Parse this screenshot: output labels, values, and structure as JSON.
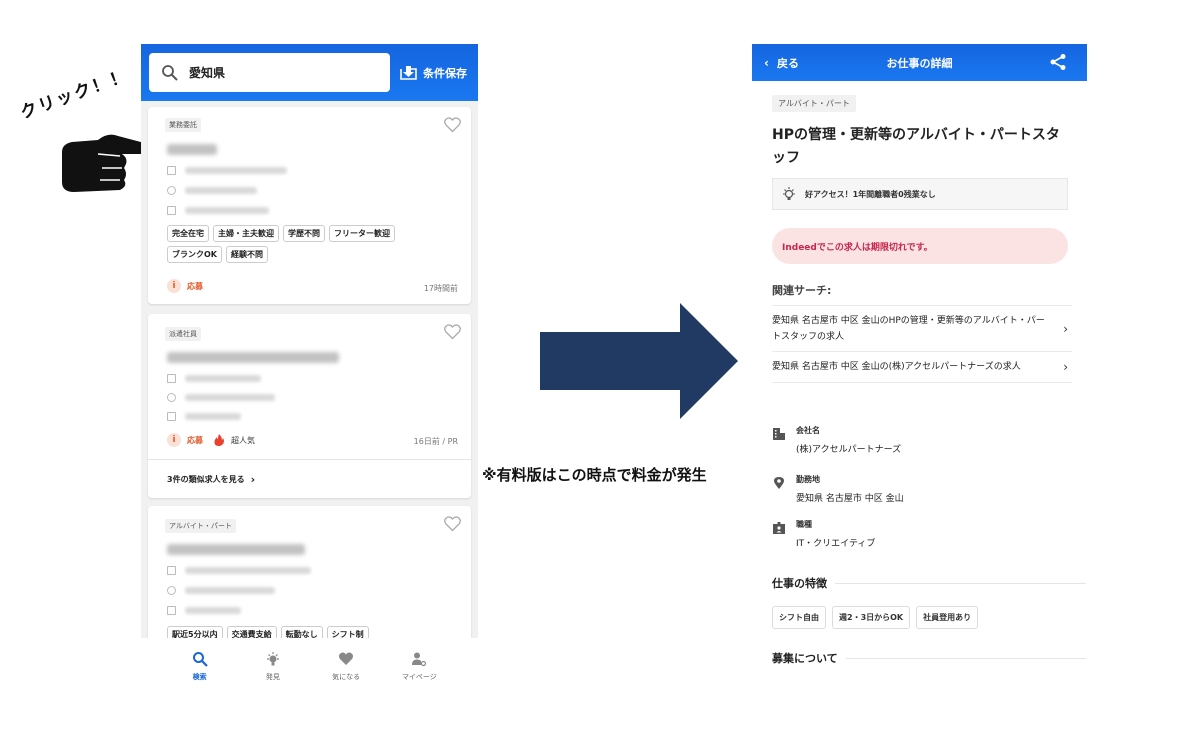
{
  "annotations": {
    "click_text": "クリック！！",
    "paid_note": "※有料版はこの時点で料金が発生"
  },
  "left": {
    "search_value": "愛知県",
    "save_label": "条件保存",
    "cards": [
      {
        "type_tag": "業務委託",
        "chips": [
          "完全在宅",
          "主婦・主夫歓迎",
          "学歴不問",
          "フリーター歓迎",
          "ブランクOK",
          "経験不問"
        ],
        "apply_label": "応募",
        "time": "17時間前"
      },
      {
        "type_tag": "派遣社員",
        "apply_label": "応募",
        "popular_label": "超人気",
        "time": "16日前 / PR",
        "similar_label": "3件の類似求人を見る"
      },
      {
        "type_tag": "アルバイト・パート",
        "chips": [
          "駅近5分以内",
          "交通費支給",
          "転勤なし",
          "シフト制"
        ]
      }
    ],
    "nav": [
      {
        "label": "検索",
        "icon": "search-icon"
      },
      {
        "label": "発見",
        "icon": "lightbulb-icon"
      },
      {
        "label": "気になる",
        "icon": "heart-icon"
      },
      {
        "label": "マイページ",
        "icon": "user-gear-icon"
      }
    ]
  },
  "right": {
    "back_label": "戻る",
    "header_title": "お仕事の詳細",
    "type_tag": "アルバイト・パート",
    "job_title": "HPの管理・更新等のアルバイト・パートスタッフ",
    "highlight": "好アクセス！1年間離職者0残業なし",
    "expired": "Indeedでこの求人は期限切れです。",
    "related_heading": "関連サーチ:",
    "related_links": [
      "愛知県 名古屋市 中区 金山のHPの管理・更新等のアルバイト・パートスタッフの求人",
      "愛知県 名古屋市 中区 金山の(株)アクセルパートナーズの求人"
    ],
    "company_label": "会社名",
    "company_value": "(株)アクセルパートナーズ",
    "location_label": "勤務地",
    "location_value": "愛知県 名古屋市 中区 金山",
    "jobtype_label": "職種",
    "jobtype_value": "IT・クリエイティブ",
    "features_heading": "仕事の特徴",
    "features": [
      "シフト自由",
      "週2・3日からOK",
      "社員登用あり"
    ],
    "recruit_heading": "募集について"
  },
  "colors": {
    "header_blue": "#1a6fe8",
    "arrow_navy": "#213a63",
    "expired_bg": "#fbe3e3",
    "expired_text": "#c7264e",
    "apply_orange": "#e15a2c"
  }
}
